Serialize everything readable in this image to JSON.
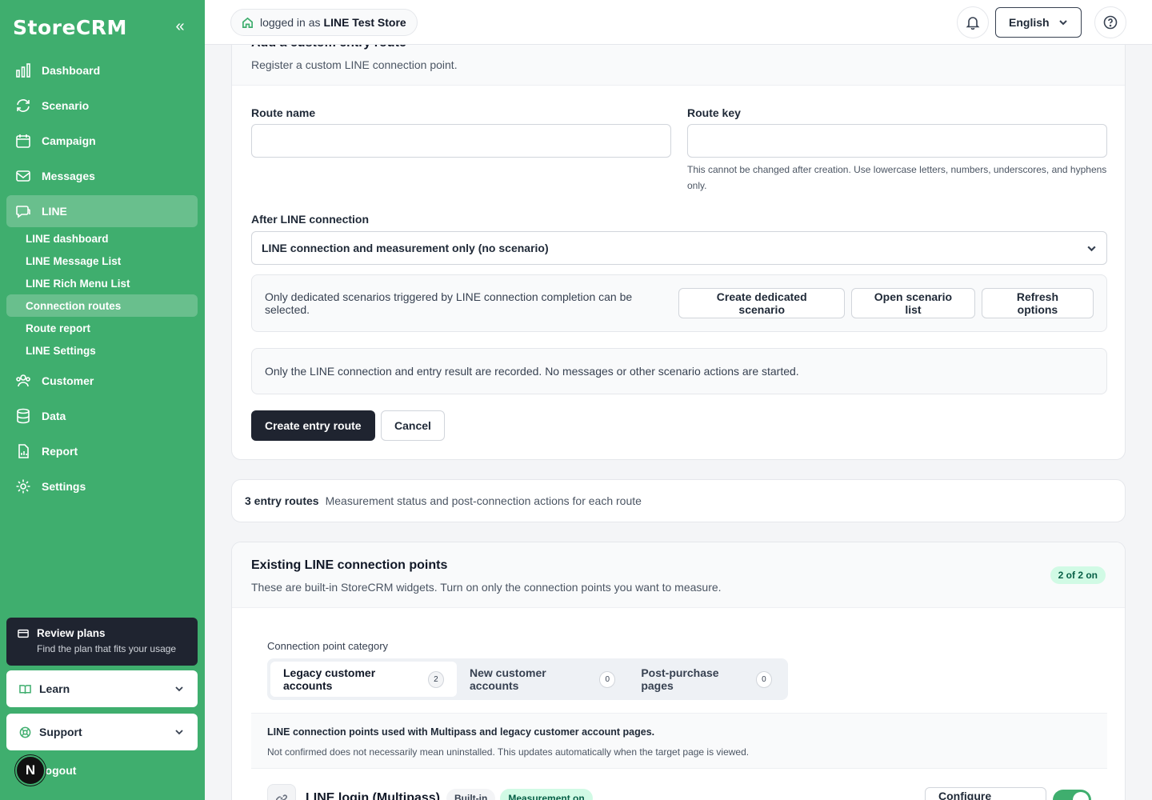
{
  "app": {
    "name": "StoreCRM"
  },
  "sidebar": {
    "collapse_glyph": "«",
    "items": [
      {
        "label": "Dashboard",
        "icon": "bar-chart-icon"
      },
      {
        "label": "Scenario",
        "icon": "refresh-icon"
      },
      {
        "label": "Campaign",
        "icon": "calendar-icon"
      },
      {
        "label": "Messages",
        "icon": "mail-icon"
      },
      {
        "label": "LINE",
        "icon": "chat-icon",
        "active": true
      },
      {
        "label": "Customer",
        "icon": "users-icon"
      },
      {
        "label": "Data",
        "icon": "database-icon"
      },
      {
        "label": "Report",
        "icon": "report-icon"
      },
      {
        "label": "Settings",
        "icon": "gear-icon"
      }
    ],
    "line_sub": [
      {
        "label": "LINE dashboard"
      },
      {
        "label": "LINE Message List"
      },
      {
        "label": "LINE Rich Menu List"
      },
      {
        "label": "Connection routes",
        "active": true
      },
      {
        "label": "Route report"
      },
      {
        "label": "LINE Settings"
      }
    ],
    "plan": {
      "title": "Review plans",
      "subtitle": "Find the plan that fits your usage"
    },
    "learn": "Learn",
    "support": "Support",
    "logout": "Logout",
    "avatar_initial": "N"
  },
  "topbar": {
    "logged_prefix": "logged in as",
    "store_name": "LINE Test Store",
    "language": "English"
  },
  "form": {
    "title": "Add a custom entry route",
    "description": "Register a custom LINE connection point.",
    "route_name_label": "Route name",
    "route_name_value": "",
    "route_key_label": "Route key",
    "route_key_value": "",
    "route_key_hint": "This cannot be changed after creation. Use lowercase letters, numbers, underscores, and hyphens only.",
    "after_label": "After LINE connection",
    "after_value": "LINE connection and measurement only (no scenario)",
    "scenario_note": "Only dedicated scenarios triggered by LINE connection completion can be selected.",
    "create_dedicated": "Create dedicated scenario",
    "open_list": "Open scenario list",
    "refresh": "Refresh options",
    "result_note": "Only the LINE connection and entry result are recorded. No messages or other scenario actions are started.",
    "submit": "Create entry route",
    "cancel": "Cancel"
  },
  "summary": {
    "count": "3 entry routes",
    "text": "Measurement status and post-connection actions for each route"
  },
  "existing": {
    "title": "Existing LINE connection points",
    "description": "These are built-in StoreCRM widgets. Turn on only the connection points you want to measure.",
    "badge": "2 of 2 on",
    "category_label": "Connection point category",
    "tabs": [
      {
        "label": "Legacy customer accounts",
        "count": "2",
        "active": true
      },
      {
        "label": "New customer accounts",
        "count": "0"
      },
      {
        "label": "Post-purchase pages",
        "count": "0"
      }
    ],
    "note_title": "LINE connection points used with Multipass and legacy customer account pages.",
    "note_sub": "Not confirmed does not necessarily mean uninstalled. This updates automatically when the target page is viewed.",
    "rows": [
      {
        "title": "LINE login (Multipass)",
        "tag1": "Built-in",
        "tag2": "Measurement on",
        "button": "Configure scenario",
        "enabled": true
      }
    ]
  },
  "colors": {
    "brand": "#3fae6e",
    "dark": "#1f2430"
  }
}
